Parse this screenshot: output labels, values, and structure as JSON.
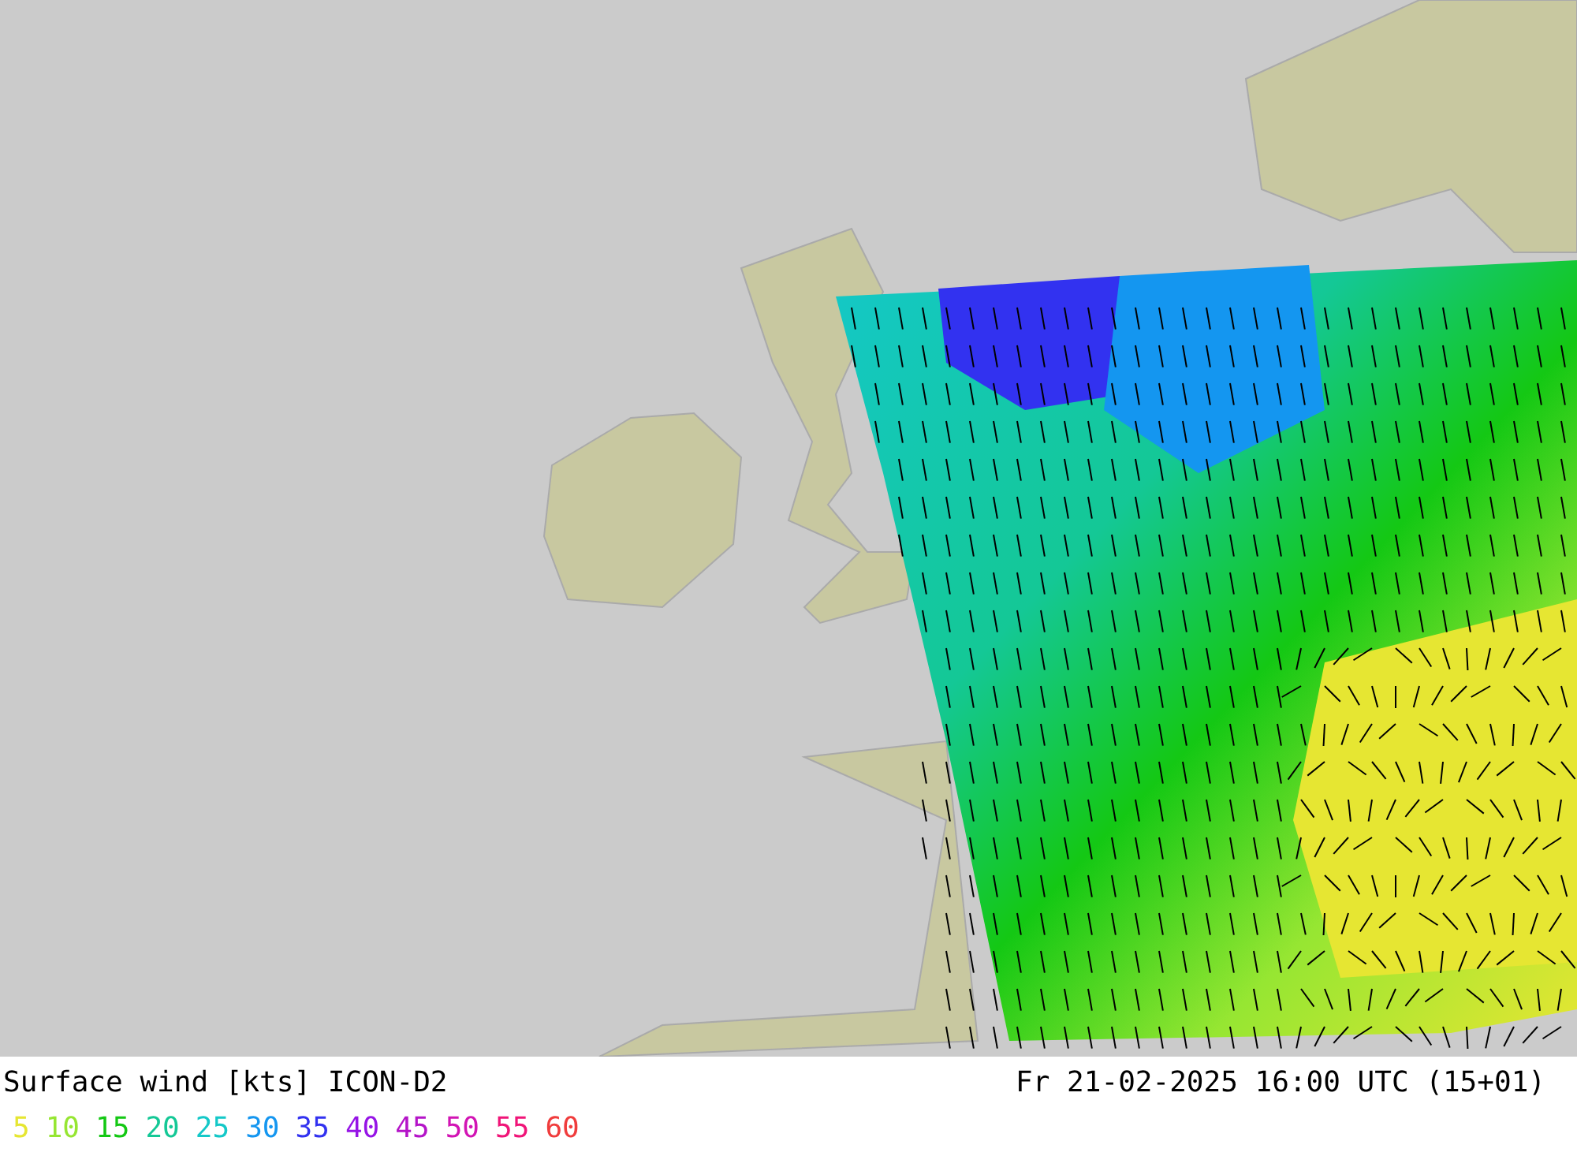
{
  "map": {
    "title": "Surface wind [kts] ICON-D2",
    "valid_time": "Fr 21-02-2025 16:00 UTC (15+01)"
  },
  "legend": [
    {
      "label": "5",
      "color": "#e6e632"
    },
    {
      "label": "10",
      "color": "#96e632"
    },
    {
      "label": "15",
      "color": "#14c814"
    },
    {
      "label": "20",
      "color": "#14c896"
    },
    {
      "label": "25",
      "color": "#14c8c8"
    },
    {
      "label": "30",
      "color": "#1496f0"
    },
    {
      "label": "35",
      "color": "#3232f0"
    },
    {
      "label": "40",
      "color": "#9614e6"
    },
    {
      "label": "45",
      "color": "#b414c8"
    },
    {
      "label": "50",
      "color": "#d214b4"
    },
    {
      "label": "55",
      "color": "#f01478"
    },
    {
      "label": "60",
      "color": "#f03c3c"
    }
  ]
}
